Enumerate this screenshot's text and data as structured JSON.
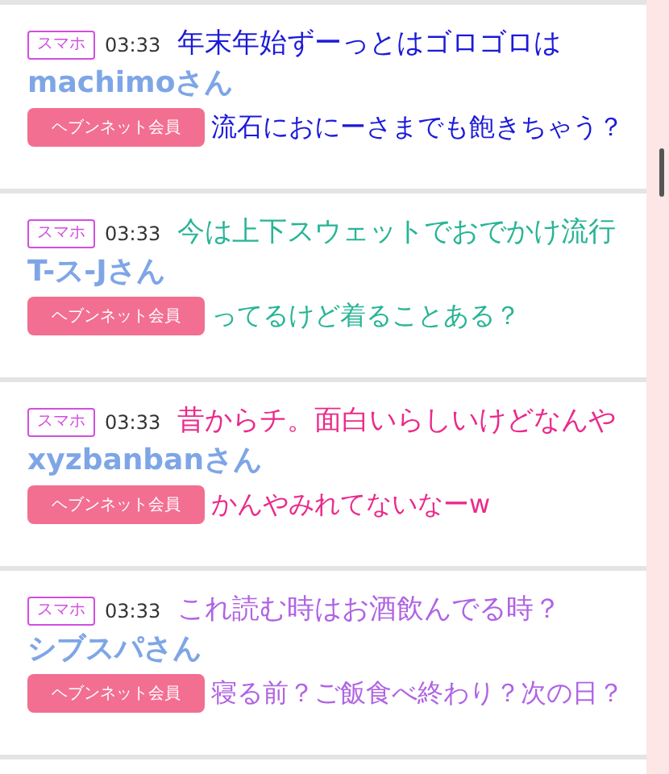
{
  "posts": [
    {
      "badge": "スマホ",
      "time": "03:33",
      "name": "machimoさん",
      "button": "ヘブンネット会員",
      "caption": {
        "color": "#1c1ad8",
        "lines": [
          "年末年始ずーっとはゴロゴロは",
          "流石におにーさまでも飽きちゃう？"
        ]
      }
    },
    {
      "badge": "スマホ",
      "time": "03:33",
      "name": "T-ス-Jさん",
      "button": "ヘブンネット会員",
      "caption": {
        "color": "#27b596",
        "lines": [
          "今は上下スウェットでおでかけ流行",
          "ってるけど着ることある？"
        ]
      }
    },
    {
      "badge": "スマホ",
      "time": "03:33",
      "name": "xyzbanbanさん",
      "button": "ヘブンネット会員",
      "caption": {
        "color": "#ea2a8c",
        "lines": [
          "昔からチ。面白いらしいけどなんや",
          "かんやみれてないなーw"
        ]
      }
    },
    {
      "badge": "スマホ",
      "time": "03:33",
      "name": "シブスパさん",
      "button": "ヘブンネット会員",
      "caption": {
        "color": "#b063e3",
        "lines": [
          "これ読む時はお酒飲んでる時？",
          "寝る前？ご飯食べ終わり？次の日？"
        ]
      }
    }
  ]
}
